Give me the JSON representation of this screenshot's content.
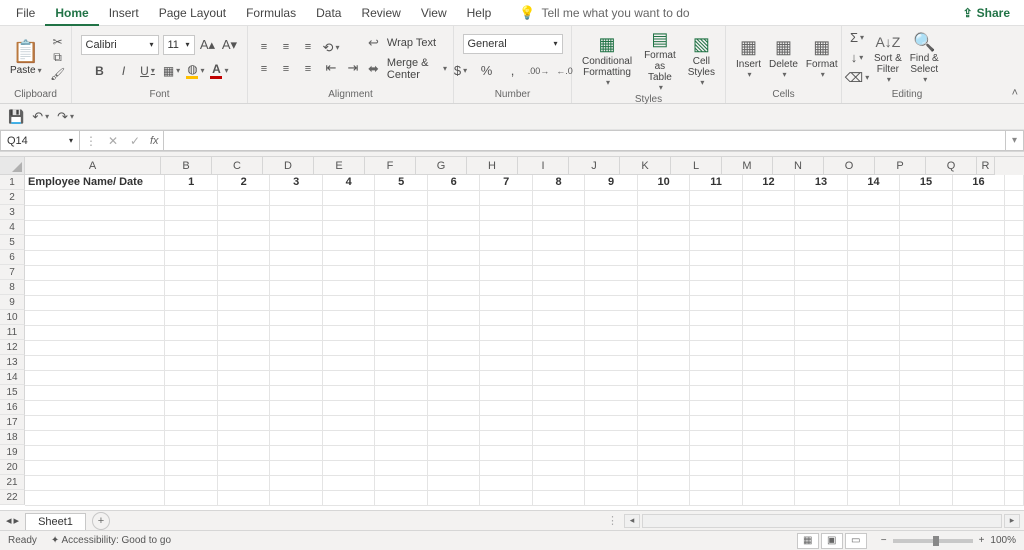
{
  "tabs": [
    "File",
    "Home",
    "Insert",
    "Page Layout",
    "Formulas",
    "Data",
    "Review",
    "View",
    "Help"
  ],
  "active_tab": "Home",
  "tell_me": "Tell me what you want to do",
  "share": "Share",
  "ribbon": {
    "clipboard": {
      "label": "Clipboard",
      "paste": "Paste"
    },
    "font": {
      "label": "Font",
      "name": "Calibri",
      "size": "11",
      "bold": "B",
      "italic": "I",
      "underline": "U"
    },
    "alignment": {
      "label": "Alignment",
      "wrap": "Wrap Text",
      "merge": "Merge & Center"
    },
    "number": {
      "label": "Number",
      "format": "General"
    },
    "styles": {
      "label": "Styles",
      "cond": "Conditional\nFormatting",
      "fmt_table": "Format as\nTable",
      "cell_styles": "Cell\nStyles"
    },
    "cells": {
      "label": "Cells",
      "insert": "Insert",
      "delete": "Delete",
      "format": "Format"
    },
    "editing": {
      "label": "Editing",
      "sort": "Sort &\nFilter",
      "find": "Find &\nSelect"
    }
  },
  "namebox": "Q14",
  "fx": "fx",
  "columns": [
    "A",
    "B",
    "C",
    "D",
    "E",
    "F",
    "G",
    "H",
    "I",
    "J",
    "K",
    "L",
    "M",
    "N",
    "O",
    "P",
    "Q",
    "R"
  ],
  "row_count": 22,
  "row1": {
    "A": "Employee Name/ Date",
    "nums": [
      "1",
      "2",
      "3",
      "4",
      "5",
      "6",
      "7",
      "8",
      "9",
      "10",
      "11",
      "12",
      "13",
      "14",
      "15",
      "16"
    ]
  },
  "sheet_tab": "Sheet1",
  "status": {
    "ready": "Ready",
    "accessibility": "Accessibility: Good to go",
    "zoom": "100%"
  },
  "chart_data": {
    "type": "table",
    "title": "Sheet1",
    "columns": [
      "Employee Name/ Date",
      "1",
      "2",
      "3",
      "4",
      "5",
      "6",
      "7",
      "8",
      "9",
      "10",
      "11",
      "12",
      "13",
      "14",
      "15",
      "16"
    ],
    "rows": []
  }
}
